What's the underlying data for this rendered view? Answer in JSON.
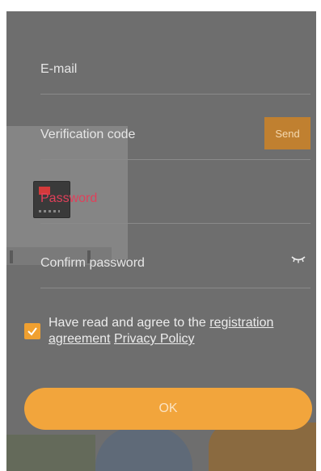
{
  "form": {
    "email_placeholder": "E-mail",
    "code_placeholder": "Verification code",
    "send_label": "Send",
    "password_placeholder": "Password",
    "confirm_placeholder": "Confirm password"
  },
  "agreement": {
    "checked": true,
    "prefix": "Have read and agree to the ",
    "link_registration": "registration agreement",
    "link_privacy": "Privacy Policy"
  },
  "ok_label": "OK",
  "colors": {
    "accent": "#f2a53c",
    "send_button": "#c08030",
    "overlay": "#6e6e6e",
    "password_text": "#e0405a"
  },
  "icons": {
    "eye": "eye-closed-icon",
    "check": "check-icon"
  }
}
